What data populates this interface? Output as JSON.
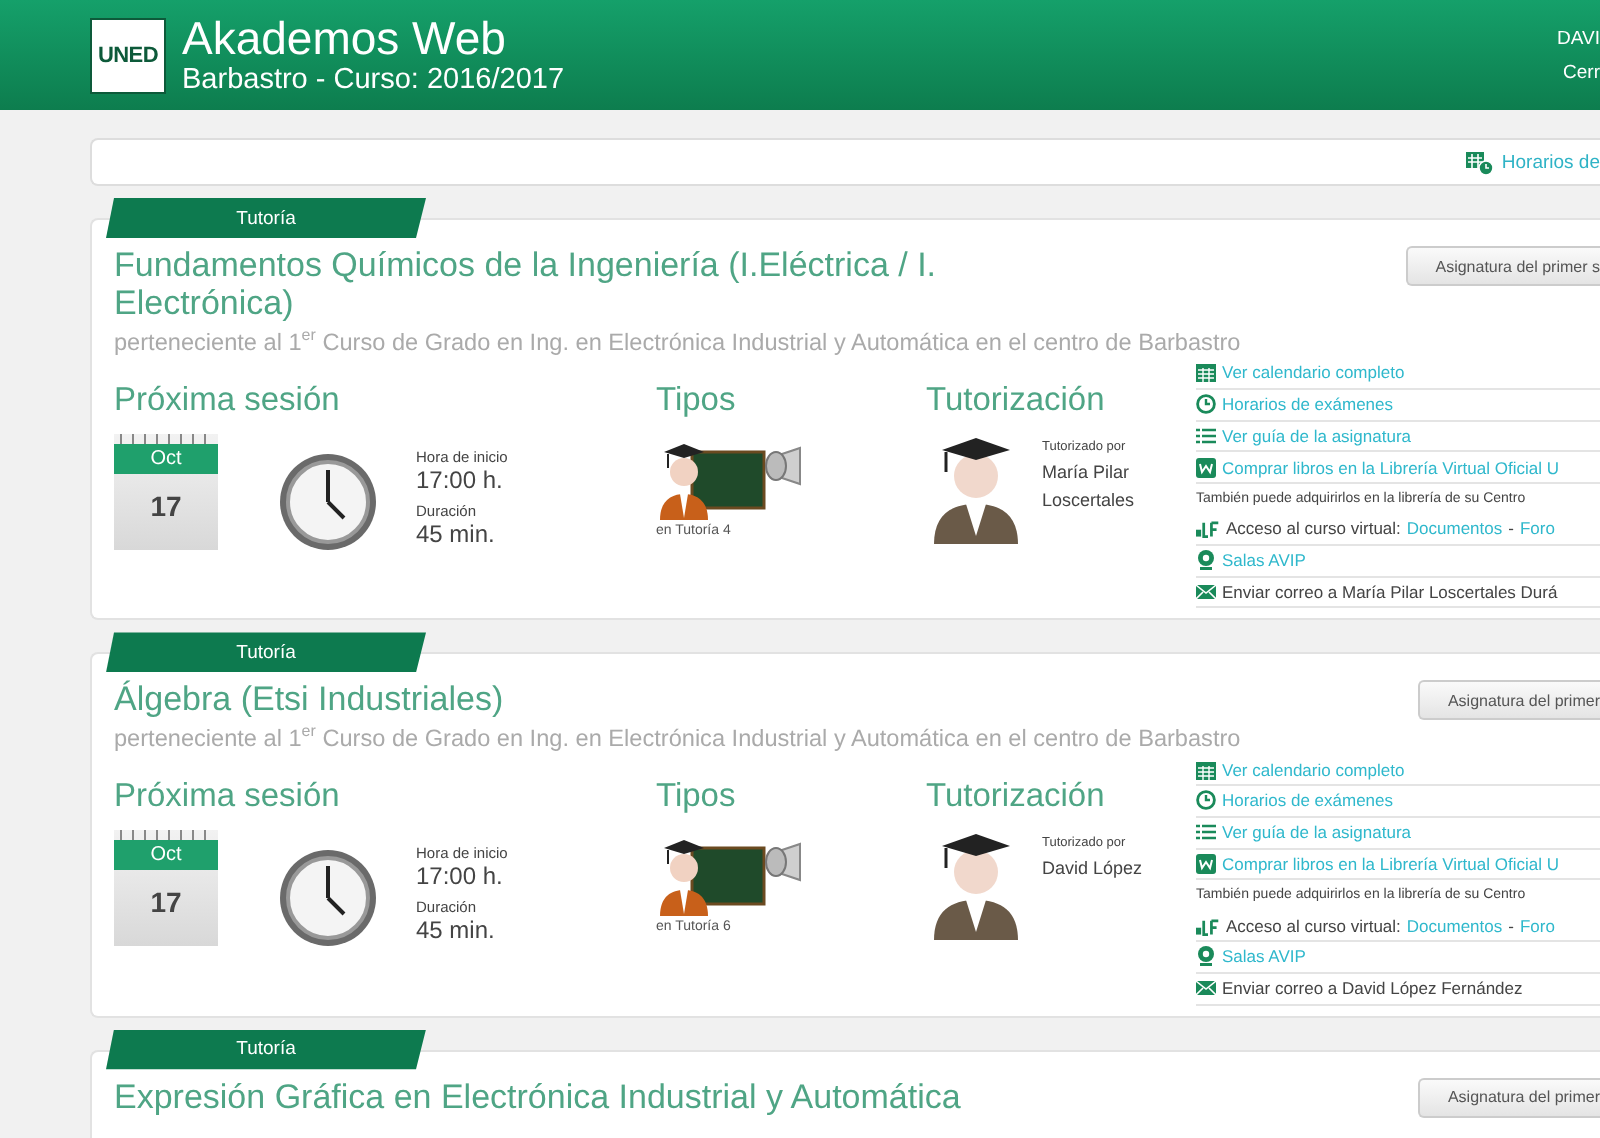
{
  "header": {
    "logo": "UNED",
    "title": "Akademos Web",
    "subtitle": "Barbastro - Curso: 2016/2017",
    "user": "DAVI",
    "logout": "Cerr"
  },
  "toolbar": {
    "link": "Horarios de"
  },
  "courses": [
    {
      "tab": "Tutoría",
      "button": "Asignatura del primer s",
      "title": "Fundamentos Químicos de la Ingeniería (I.Eléctrica / I. Electrónica)",
      "subtitle": "perteneciente al 1$^{er}$ Curso de Grado en Ing. en Electrónica Industrial y Automática en el centro de Barbastro",
      "session": {
        "heading": "Próxima sesión",
        "month": "Oct",
        "day": "17",
        "start_label": "Hora de inicio",
        "start": "17:00 h.",
        "duration_label": "Duración",
        "duration": "45 min."
      },
      "types": {
        "heading": "Tipos",
        "caption": "en Tutoría 4"
      },
      "tutor": {
        "heading": "Tutorización",
        "label": "Tutorizado por",
        "name": "María Pilar Loscertales"
      },
      "links": [
        {
          "kind": "calendar",
          "text": "Ver calendario completo"
        },
        {
          "kind": "clock",
          "text": "Horarios de exámenes"
        },
        {
          "kind": "list",
          "text": "Ver guía de la asignatura"
        },
        {
          "kind": "book",
          "text": "Comprar libros en la Librería Virtual Oficial U"
        },
        {
          "kind": "note",
          "text": "También puede adquirirlos en la librería de su Centro"
        },
        {
          "kind": "virtual",
          "text": "Acceso al curso virtual:",
          "links": [
            "Documentos",
            "Foro"
          ],
          "separator": "-"
        },
        {
          "kind": "avip",
          "text": "Salas AVIP"
        },
        {
          "kind": "mail",
          "text": "Enviar correo a María Pilar Loscertales Durá"
        }
      ]
    },
    {
      "tab": "Tutoría",
      "button": "Asignatura del primer",
      "title": "Álgebra (Etsi Industriales)",
      "subtitle": "perteneciente al 1$^{er}$ Curso de Grado en Ing. en Electrónica Industrial y Automática en el centro de Barbastro",
      "session": {
        "heading": "Próxima sesión",
        "month": "Oct",
        "day": "17",
        "start_label": "Hora de inicio",
        "start": "17:00 h.",
        "duration_label": "Duración",
        "duration": "45 min."
      },
      "types": {
        "heading": "Tipos",
        "caption": "en Tutoría 6"
      },
      "tutor": {
        "heading": "Tutorización",
        "label": "Tutorizado por",
        "name": "David López"
      },
      "links": [
        {
          "kind": "calendar",
          "text": "Ver calendario completo"
        },
        {
          "kind": "clock",
          "text": "Horarios de exámenes"
        },
        {
          "kind": "list",
          "text": "Ver guía de la asignatura"
        },
        {
          "kind": "book",
          "text": "Comprar libros en la Librería Virtual Oficial U"
        },
        {
          "kind": "note",
          "text": "También puede adquirirlos en la librería de su Centro"
        },
        {
          "kind": "virtual",
          "text": "Acceso al curso virtual:",
          "links": [
            "Documentos",
            "Foro"
          ],
          "separator": "-"
        },
        {
          "kind": "avip",
          "text": "Salas AVIP"
        },
        {
          "kind": "mail",
          "text": "Enviar correo a David López Fernández"
        }
      ]
    },
    {
      "tab": "Tutoría",
      "button": "Asignatura del primer",
      "title": "Expresión Gráfica en Electrónica Industrial y Automática"
    }
  ]
}
